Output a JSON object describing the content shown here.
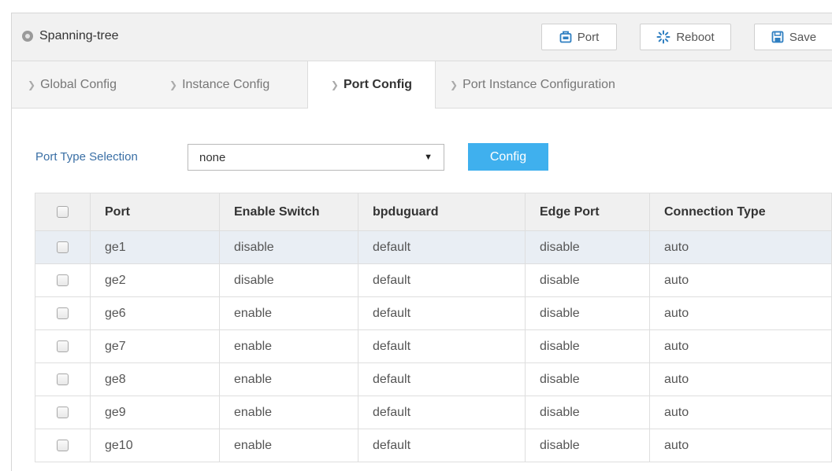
{
  "header": {
    "title": "Spanning-tree",
    "buttons": {
      "port": "Port",
      "reboot": "Reboot",
      "save": "Save"
    }
  },
  "tabs": [
    {
      "label": "Global Config",
      "active": false
    },
    {
      "label": "Instance Config",
      "active": false
    },
    {
      "label": "Port Config",
      "active": true
    },
    {
      "label": "Port Instance Configuration",
      "active": false
    }
  ],
  "form": {
    "port_type_label": "Port Type Selection",
    "port_type_value": "none",
    "config_button": "Config"
  },
  "table": {
    "columns": [
      "Port",
      "Enable Switch",
      "bpduguard",
      "Edge Port",
      "Connection Type"
    ],
    "rows": [
      {
        "port": "ge1",
        "enable_switch": "disable",
        "bpduguard": "default",
        "edge_port": "disable",
        "connection_type": "auto"
      },
      {
        "port": "ge2",
        "enable_switch": "disable",
        "bpduguard": "default",
        "edge_port": "disable",
        "connection_type": "auto"
      },
      {
        "port": "ge6",
        "enable_switch": "enable",
        "bpduguard": "default",
        "edge_port": "disable",
        "connection_type": "auto"
      },
      {
        "port": "ge7",
        "enable_switch": "enable",
        "bpduguard": "default",
        "edge_port": "disable",
        "connection_type": "auto"
      },
      {
        "port": "ge8",
        "enable_switch": "enable",
        "bpduguard": "default",
        "edge_port": "disable",
        "connection_type": "auto"
      },
      {
        "port": "ge9",
        "enable_switch": "enable",
        "bpduguard": "default",
        "edge_port": "disable",
        "connection_type": "auto"
      },
      {
        "port": "ge10",
        "enable_switch": "enable",
        "bpduguard": "default",
        "edge_port": "disable",
        "connection_type": "auto"
      }
    ]
  },
  "colors": {
    "accent": "#3fb0ee",
    "link": "#3a6fa5",
    "icon_blue": "#2f7fc1"
  }
}
